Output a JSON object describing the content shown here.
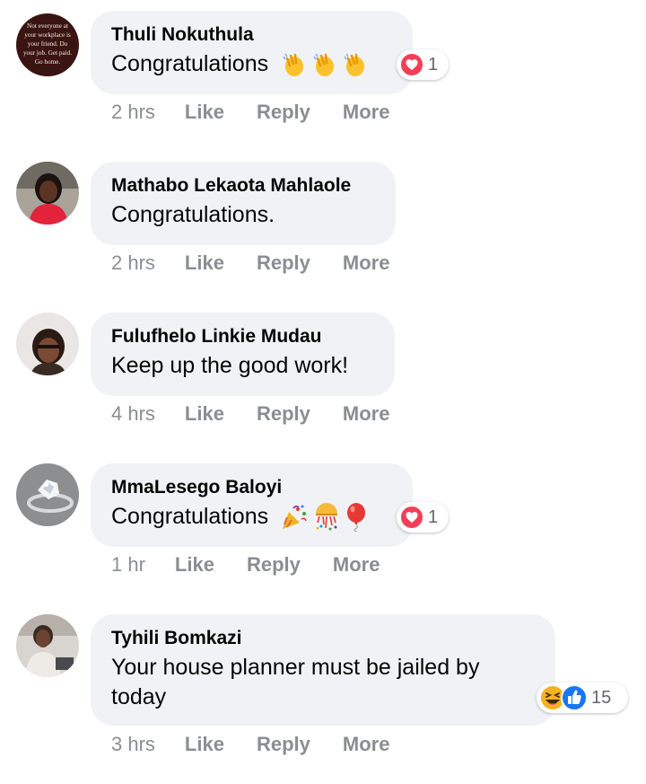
{
  "comments": [
    {
      "author": "Thuli Nokuthula",
      "text": "Congratulations",
      "emojis": [
        "clapping-hands",
        "clapping-hands",
        "clapping-hands"
      ],
      "avatar_text": [
        "Not everyone at",
        "your workplace is",
        "your friend. Do",
        "your job. Get paid.",
        "Go home."
      ],
      "reaction": {
        "icons": [
          "heart-icon"
        ],
        "count": "1"
      },
      "time": "2 hrs",
      "actions": [
        "Like",
        "Reply",
        "More"
      ]
    },
    {
      "author": "Mathabo Lekaota Mahlaole",
      "text": "Congratulations.",
      "time": "2 hrs",
      "actions": [
        "Like",
        "Reply",
        "More"
      ]
    },
    {
      "author": "Fulufhelo Linkie Mudau",
      "text": "Keep up the good work!",
      "time": "4 hrs",
      "actions": [
        "Like",
        "Reply",
        "More"
      ]
    },
    {
      "author": "MmaLesego Baloyi",
      "text": "Congratulations",
      "emojis": [
        "party-popper",
        "confetti-ball",
        "balloon"
      ],
      "reaction": {
        "icons": [
          "heart-icon"
        ],
        "count": "1"
      },
      "time": "1 hr",
      "actions": [
        "Like",
        "Reply",
        "More"
      ]
    },
    {
      "author": "Tyhili Bomkazi",
      "text": "Your house planner must be jailed by today",
      "reaction": {
        "icons": [
          "haha-icon",
          "like-icon"
        ],
        "count": "15"
      },
      "time": "3 hrs",
      "actions": [
        "Like",
        "Reply",
        "More"
      ]
    }
  ],
  "colors": {
    "bubble": "#f0f2f5",
    "meta_text": "#8a8d91",
    "heart_red": "#f33e58",
    "like_blue": "#1877f2",
    "haha_yellow": "#f7b125"
  }
}
